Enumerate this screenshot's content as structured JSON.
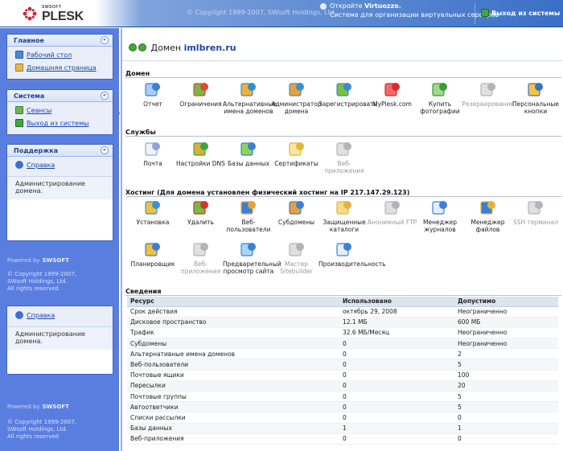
{
  "header": {
    "brand_small": "SWSOFT",
    "brand": "PLESK",
    "copyright": "© Copyright 1999-2007, SWsoft Holdings, Ltd.",
    "promo_prefix": "Откройте ",
    "promo_brand": "Virtuozzo.",
    "promo_line2": "Система для организации виртуальных серверов",
    "logout": "Выход из системы"
  },
  "sidebar": {
    "main_title": "Главное",
    "main_items": [
      {
        "label": "Рабочий стол",
        "icon": "desktop-icon"
      },
      {
        "label": "Домашняя страница",
        "icon": "home-icon"
      }
    ],
    "system_title": "Система",
    "system_items": [
      {
        "label": "Сеансы",
        "icon": "sessions-icon"
      },
      {
        "label": "Выход из системы",
        "icon": "logout-icon"
      }
    ],
    "support_title": "Поддержка",
    "support_link": "Справка",
    "support_text": "Администрирование домена.",
    "powered_by": "Powered by",
    "powered_brand": "SWSOFT",
    "copy1": "© Copyright 1999-2007,",
    "copy2": "SWsoft Holdings, Ltd.",
    "copy3": "All rights reserved",
    "help_link": "Справка",
    "help_text": "Администрирование домена.",
    "powered_by2": "Powered by",
    "powered_brand2": "SWSOFT",
    "copy1b": "© Copyright 1999-2007,",
    "copy2b": "SWsoft Holdings, Ltd.",
    "copy3b": "All rights reserved"
  },
  "main": {
    "title_prefix": "Домен ",
    "domain": "imlbren.ru",
    "domain_section": "Домен",
    "domain_tools": [
      {
        "label": "Отчет",
        "icon": "report-icon",
        "enabled": true
      },
      {
        "label": "Ограничения",
        "icon": "limits-icon",
        "enabled": true
      },
      {
        "label": "Альтернативные имена доменов",
        "icon": "domain-aliases-icon",
        "enabled": true
      },
      {
        "label": "Администратор домена",
        "icon": "domain-admin-icon",
        "enabled": true
      },
      {
        "label": "Зарегистрировать",
        "icon": "register-icon",
        "enabled": true
      },
      {
        "label": "MyPlesk.com",
        "icon": "myplesk-icon",
        "enabled": true
      },
      {
        "label": "Купить фотографии",
        "icon": "buy-photos-icon",
        "enabled": true
      },
      {
        "label": "Резервирование",
        "icon": "backup-icon",
        "enabled": false
      },
      {
        "label": "Персональные кнопки",
        "icon": "custom-buttons-icon",
        "enabled": true
      }
    ],
    "services_section": "Службы",
    "services_tools": [
      {
        "label": "Почта",
        "icon": "mail-icon",
        "enabled": true
      },
      {
        "label": "Настройки DNS",
        "icon": "dns-icon",
        "enabled": true
      },
      {
        "label": "Базы данных",
        "icon": "databases-icon",
        "enabled": true
      },
      {
        "label": "Сертификаты",
        "icon": "certificates-icon",
        "enabled": true
      },
      {
        "label": "Веб-приложения",
        "icon": "web-apps-icon",
        "enabled": false
      }
    ],
    "hosting_section": "Хостинг (Для домена установлен физический хостинг на IP 217.147.29.123)",
    "hosting_tools_row1": [
      {
        "label": "Установка",
        "icon": "setup-icon",
        "enabled": true
      },
      {
        "label": "Удалить",
        "icon": "delete-icon",
        "enabled": true
      },
      {
        "label": "Веб-пользователи",
        "icon": "web-users-icon",
        "enabled": true
      },
      {
        "label": "Субдомены",
        "icon": "subdomains-icon",
        "enabled": true
      },
      {
        "label": "Защищенные каталоги",
        "icon": "protected-dirs-icon",
        "enabled": true
      },
      {
        "label": "Анонимный FTP",
        "icon": "anonymous-ftp-icon",
        "enabled": false
      },
      {
        "label": "Менеджер журналов",
        "icon": "log-manager-icon",
        "enabled": true
      },
      {
        "label": "Менеджер файлов",
        "icon": "file-manager-icon",
        "enabled": true
      },
      {
        "label": "SSH терминал",
        "icon": "ssh-terminal-icon",
        "enabled": false
      }
    ],
    "hosting_tools_row2": [
      {
        "label": "Планировщик",
        "icon": "scheduler-icon",
        "enabled": true
      },
      {
        "label": "Веб-приложения",
        "icon": "web-apps-icon",
        "enabled": false
      },
      {
        "label": "Предварительный просмотр сайта",
        "icon": "site-preview-icon",
        "enabled": true
      },
      {
        "label": "Мастер Sitebuilder",
        "icon": "sitebuilder-icon",
        "enabled": false
      },
      {
        "label": "Производительность",
        "icon": "performance-icon",
        "enabled": true
      }
    ],
    "info_section": "Сведения",
    "table": {
      "headers": [
        "Ресурс",
        "Использовано",
        "Допустимо"
      ],
      "rows": [
        [
          "Срок действия",
          "октябрь 29, 2008",
          "Неограниченно"
        ],
        [
          "Дисковое пространство",
          "12.1 МБ",
          "600 МБ"
        ],
        [
          "Трафик",
          "32.6 МБ/Месяц",
          "Неограниченно"
        ],
        [
          "Субдомены",
          "0",
          "Неограниченно"
        ],
        [
          "Альтернативные имена доменов",
          "0",
          "2"
        ],
        [
          "Веб-пользователи",
          "0",
          "5"
        ],
        [
          "Почтовые ящики",
          "0",
          "100"
        ],
        [
          "Пересылки",
          "0",
          "20"
        ],
        [
          "Почтовые группы",
          "0",
          "5"
        ],
        [
          "Автоответчики",
          "0",
          "5"
        ],
        [
          "Списки рассылки",
          "0",
          "0"
        ],
        [
          "Базы данных",
          "1",
          "1"
        ],
        [
          "Веб-приложения",
          "0",
          "0"
        ]
      ]
    }
  }
}
